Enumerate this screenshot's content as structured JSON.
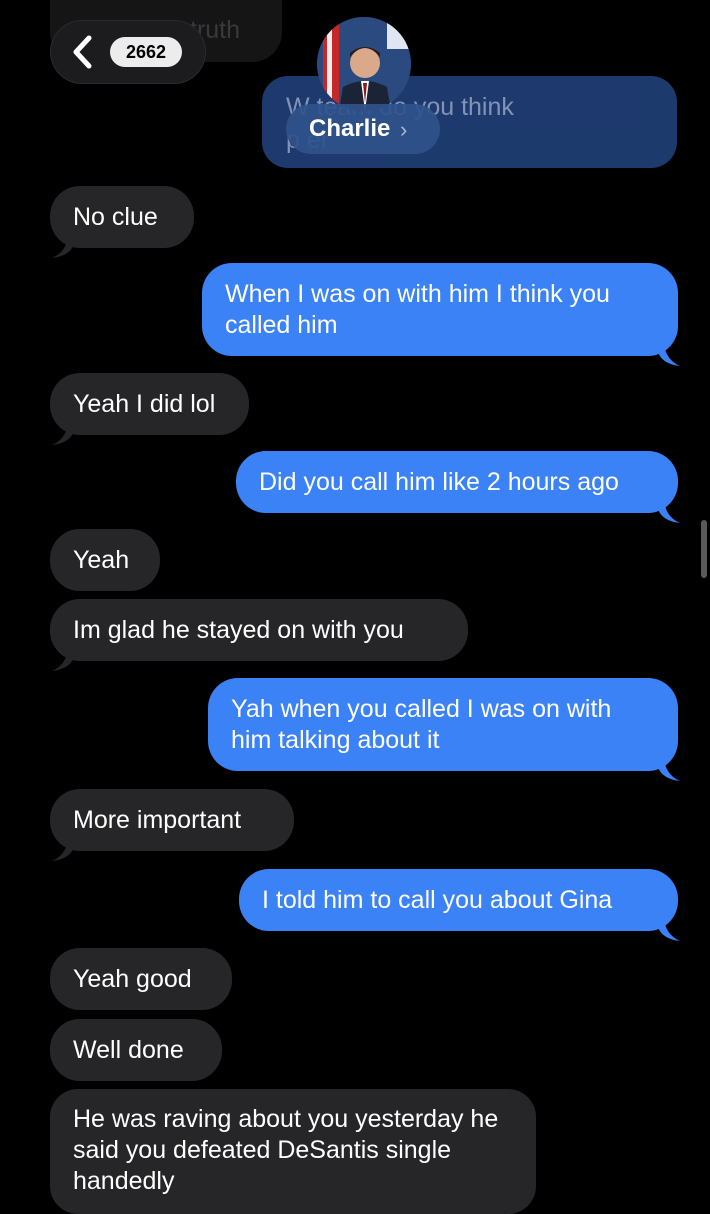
{
  "header": {
    "back_count": "2662",
    "contact_name": "Charlie",
    "faded_prev_text": "truth",
    "blurred_sent_line1": "W         team do you think",
    "blurred_sent_line2": "p                    er"
  },
  "messages": [
    {
      "dir": "in",
      "text": "No clue"
    },
    {
      "dir": "out",
      "text": "When I was on with him I think you called him"
    },
    {
      "dir": "in",
      "text": "Yeah I did lol"
    },
    {
      "dir": "out",
      "text": "Did you call him like 2 hours ago"
    },
    {
      "dir": "in",
      "text": "Yeah"
    },
    {
      "dir": "in",
      "text": "Im glad he stayed on with you"
    },
    {
      "dir": "out",
      "text": "Yah when you called I was on with him talking about it"
    },
    {
      "dir": "in",
      "text": "More important"
    },
    {
      "dir": "out",
      "text": "I told him to call you about Gina"
    },
    {
      "dir": "in",
      "text": "Yeah good"
    },
    {
      "dir": "in",
      "text": "Well done"
    },
    {
      "dir": "in",
      "text": "He was raving about you yesterday he said you defeated DeSantis single handedly"
    }
  ],
  "colors": {
    "incoming_bubble": "#262628",
    "outgoing_bubble": "#3b82f6",
    "background": "#000000"
  }
}
